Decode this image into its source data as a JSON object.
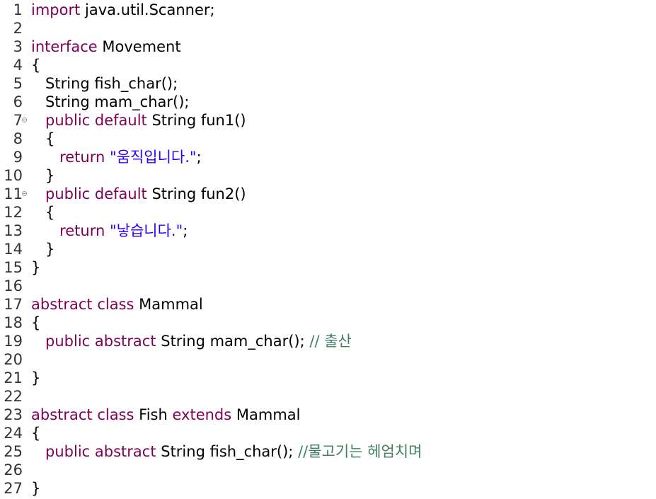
{
  "colors": {
    "keyword": "#7f0055",
    "string": "#2a00ff",
    "comment": "#3f7f5f",
    "text": "#000000",
    "background": "#ffffff"
  },
  "lines": [
    {
      "num": "1",
      "parts": [
        [
          "kw",
          "import"
        ],
        [
          "tx",
          " java.util.Scanner;"
        ]
      ]
    },
    {
      "num": "2",
      "parts": []
    },
    {
      "num": "3",
      "parts": [
        [
          "kw",
          "interface"
        ],
        [
          "tx",
          " Movement"
        ]
      ]
    },
    {
      "num": "4",
      "parts": [
        [
          "tx",
          "{"
        ]
      ]
    },
    {
      "num": "5",
      "parts": [
        [
          "tx",
          "   String fish_char();"
        ]
      ]
    },
    {
      "num": "6",
      "parts": [
        [
          "tx",
          "   String mam_char();"
        ]
      ]
    },
    {
      "num": "7",
      "fold": true,
      "parts": [
        [
          "tx",
          "   "
        ],
        [
          "kw",
          "public"
        ],
        [
          "tx",
          " "
        ],
        [
          "kw",
          "default"
        ],
        [
          "tx",
          " String fun1()"
        ]
      ]
    },
    {
      "num": "8",
      "parts": [
        [
          "tx",
          "   {"
        ]
      ]
    },
    {
      "num": "9",
      "parts": [
        [
          "tx",
          "      "
        ],
        [
          "kw",
          "return"
        ],
        [
          "tx",
          " "
        ],
        [
          "str",
          "\"움직입니다.\""
        ],
        [
          "tx",
          ";"
        ]
      ]
    },
    {
      "num": "10",
      "parts": [
        [
          "tx",
          "   }"
        ]
      ]
    },
    {
      "num": "11",
      "fold": true,
      "parts": [
        [
          "tx",
          "   "
        ],
        [
          "kw",
          "public"
        ],
        [
          "tx",
          " "
        ],
        [
          "kw",
          "default"
        ],
        [
          "tx",
          " String fun2()"
        ]
      ]
    },
    {
      "num": "12",
      "parts": [
        [
          "tx",
          "   {"
        ]
      ]
    },
    {
      "num": "13",
      "parts": [
        [
          "tx",
          "      "
        ],
        [
          "kw",
          "return"
        ],
        [
          "tx",
          " "
        ],
        [
          "str",
          "\"낳습니다.\""
        ],
        [
          "tx",
          ";"
        ]
      ]
    },
    {
      "num": "14",
      "parts": [
        [
          "tx",
          "   }"
        ]
      ]
    },
    {
      "num": "15",
      "parts": [
        [
          "tx",
          "}"
        ]
      ]
    },
    {
      "num": "16",
      "parts": []
    },
    {
      "num": "17",
      "parts": [
        [
          "kw",
          "abstract"
        ],
        [
          "tx",
          " "
        ],
        [
          "kw",
          "class"
        ],
        [
          "tx",
          " Mammal"
        ]
      ]
    },
    {
      "num": "18",
      "parts": [
        [
          "tx",
          "{"
        ]
      ]
    },
    {
      "num": "19",
      "parts": [
        [
          "tx",
          "   "
        ],
        [
          "kw",
          "public"
        ],
        [
          "tx",
          " "
        ],
        [
          "kw",
          "abstract"
        ],
        [
          "tx",
          " String mam_char(); "
        ],
        [
          "cm",
          "// 출산"
        ]
      ]
    },
    {
      "num": "20",
      "parts": []
    },
    {
      "num": "21",
      "parts": [
        [
          "tx",
          "}"
        ]
      ]
    },
    {
      "num": "22",
      "parts": []
    },
    {
      "num": "23",
      "parts": [
        [
          "kw",
          "abstract"
        ],
        [
          "tx",
          " "
        ],
        [
          "kw",
          "class"
        ],
        [
          "tx",
          " Fish "
        ],
        [
          "kw",
          "extends"
        ],
        [
          "tx",
          " Mammal"
        ]
      ]
    },
    {
      "num": "24",
      "parts": [
        [
          "tx",
          "{"
        ]
      ]
    },
    {
      "num": "25",
      "parts": [
        [
          "tx",
          "   "
        ],
        [
          "kw",
          "public"
        ],
        [
          "tx",
          " "
        ],
        [
          "kw",
          "abstract"
        ],
        [
          "tx",
          " String fish_char(); "
        ],
        [
          "cm",
          "//물고기는 헤엄치며"
        ]
      ]
    },
    {
      "num": "26",
      "parts": []
    },
    {
      "num": "27",
      "parts": [
        [
          "tx",
          "}"
        ]
      ]
    }
  ]
}
